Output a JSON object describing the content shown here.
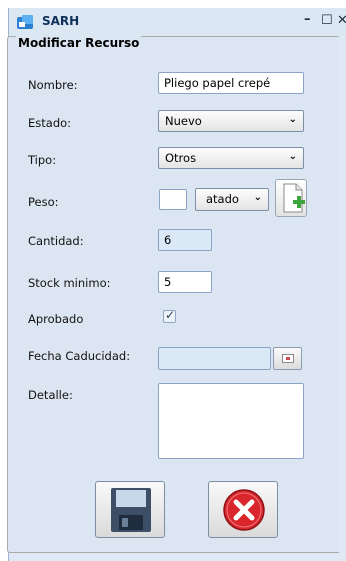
{
  "window": {
    "title": "SARH",
    "controls": {
      "minimize": "–",
      "maximize": "☐",
      "close": "✕"
    }
  },
  "form": {
    "legend": "Modificar Recurso",
    "nombre": {
      "label": "Nombre:",
      "value": "Pliego papel crepé"
    },
    "estado": {
      "label": "Estado:",
      "value": "Nuevo"
    },
    "tipo": {
      "label": "Tipo:",
      "value": "Otros"
    },
    "peso": {
      "label": "Peso:",
      "value": "",
      "unit": "atado"
    },
    "cantidad": {
      "label": "Cantidad:",
      "value": "6"
    },
    "stock_minimo": {
      "label": "Stock minimo:",
      "value": "5"
    },
    "aprobado": {
      "label": "Aprobado",
      "checked": true
    },
    "fecha_caducidad": {
      "label": "Fecha Caducidad:",
      "value": ""
    },
    "detalle": {
      "label": "Detalle:",
      "value": ""
    }
  },
  "actions": {
    "save_icon": "floppy-disk-icon",
    "cancel_icon": "cancel-icon"
  },
  "colors": {
    "title_text": "#10305a",
    "panel_bg": "#dce6f3",
    "cancel_red": "#d9252c"
  }
}
